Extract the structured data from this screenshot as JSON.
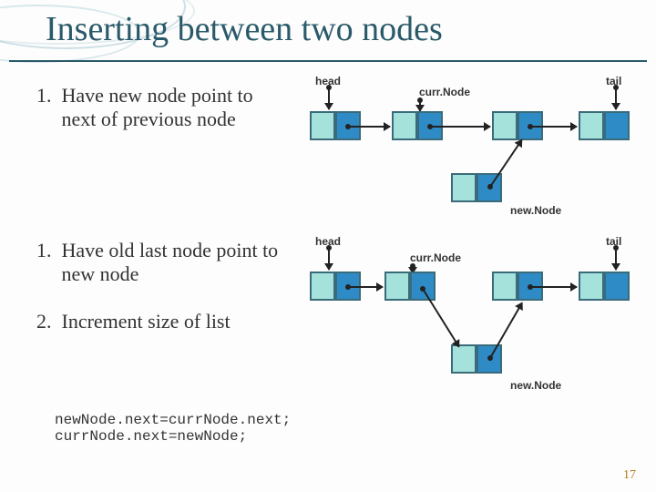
{
  "title": "Inserting between two nodes",
  "page_number": "17",
  "steps": {
    "s1": {
      "num": "1.",
      "text": "Have new node point to next of previous node"
    },
    "s2": {
      "num": "1.",
      "text": "Have old last node point to new node"
    },
    "s3": {
      "num": "2.",
      "text": "Increment size of list"
    }
  },
  "code_line1": "newNode.next=currNode.next;",
  "code_line2": "currNode.next=newNode;",
  "diagram": {
    "head": "head",
    "tail": "tail",
    "currNode": "curr.Node",
    "newNode": "new.Node"
  }
}
